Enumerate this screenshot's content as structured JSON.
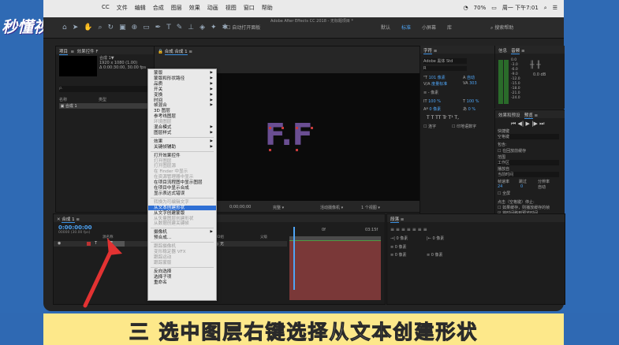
{
  "watermark": "秒懂视频",
  "mac_menu": [
    "CC",
    "文件",
    "编辑",
    "合成",
    "图层",
    "效果",
    "动画",
    "视图",
    "窗口",
    "帮助"
  ],
  "mac_status": {
    "battery": "70%",
    "clock": "周一 下午7:01"
  },
  "app_title": "Adobe After Effects CC 2018 - 无标题项目 *",
  "toolbar": {
    "snap_label": "自动打开面板",
    "workspaces": [
      "默认",
      "标准",
      "小屏幕",
      "库"
    ],
    "active_ws": "标准",
    "help_search": "搜索帮助"
  },
  "project_panel": {
    "tab": "项目",
    "tab2": "效果控件 F",
    "comp_name": "合成 1▼",
    "comp_info": "1920 x 1080 (1.00)",
    "duration": "Δ 0:00:30:00, 30.00 fps",
    "search_placeholder": "ρ.",
    "col_name": "名称",
    "col_type": "类型",
    "item": "合成 1"
  },
  "viewer": {
    "tab": "合成 合成 1",
    "letters": "F.F",
    "zoom": "完整",
    "camera": "活动摄像机",
    "view": "1 个视图",
    "timecode": "0;00;00;00"
  },
  "context_menu": {
    "items": [
      {
        "label": "蒙版",
        "sub": true,
        "dis": false
      },
      {
        "label": "蒙版和形状路径",
        "sub": true,
        "dis": false
      },
      {
        "label": "品质",
        "sub": true,
        "dis": false
      },
      {
        "label": "开关",
        "sub": true,
        "dis": false
      },
      {
        "label": "变换",
        "sub": true,
        "dis": false
      },
      {
        "label": "时间",
        "sub": true,
        "dis": false
      },
      {
        "label": "帧混合",
        "sub": true,
        "dis": false
      },
      {
        "label": "3D 图层",
        "sub": false,
        "dis": false
      },
      {
        "label": "参考线图层",
        "sub": false,
        "dis": false
      },
      {
        "label": "环境图层",
        "sub": false,
        "dis": true
      },
      {
        "label": "混合模式",
        "sub": true,
        "dis": false
      },
      {
        "label": "图层样式",
        "sub": true,
        "dis": false
      },
      {
        "label": "效果",
        "sub": true,
        "dis": false
      },
      {
        "label": "关键帧辅助",
        "sub": true,
        "dis": false
      },
      {
        "label": "打开效果控件",
        "sub": false,
        "dis": false
      },
      {
        "label": "打开图层",
        "sub": false,
        "dis": true
      },
      {
        "label": "打开图层源",
        "sub": false,
        "dis": true
      },
      {
        "label": "在 Finder 中显示",
        "sub": false,
        "dis": true
      },
      {
        "label": "在资源管理器中显示",
        "sub": false,
        "dis": true
      },
      {
        "label": "在项目流程图中显示图层",
        "sub": false,
        "dis": false
      },
      {
        "label": "在项目中显示合成",
        "sub": false,
        "dis": false
      },
      {
        "label": "显示表达式错误",
        "sub": false,
        "dis": false
      },
      {
        "label": "转换为可编辑文字",
        "sub": false,
        "dis": true
      },
      {
        "label": "从文本创建形状",
        "sub": false,
        "dis": false,
        "hi": true
      },
      {
        "label": "从文字创建蒙版",
        "sub": false,
        "dis": false
      },
      {
        "label": "从矢量图层创建形状",
        "sub": false,
        "dis": true
      },
      {
        "label": "从数据创建关键帧",
        "sub": false,
        "dis": true
      },
      {
        "label": "摄像机",
        "sub": true,
        "dis": false
      },
      {
        "label": "预合成...",
        "sub": false,
        "dis": false
      },
      {
        "label": "跟踪摄像机",
        "sub": false,
        "dis": true
      },
      {
        "label": "变形稳定器 VFX",
        "sub": false,
        "dis": true
      },
      {
        "label": "跟踪运动",
        "sub": false,
        "dis": true
      },
      {
        "label": "跟踪蒙版",
        "sub": false,
        "dis": true
      },
      {
        "label": "反向选择",
        "sub": false,
        "dis": false
      },
      {
        "label": "选择子项",
        "sub": false,
        "dis": false
      },
      {
        "label": "重命名",
        "sub": false,
        "dis": false
      }
    ]
  },
  "timeline": {
    "tab": "合成 1",
    "timecode": "0:00:00:00",
    "fps": "00000 (30.00 fps)",
    "col_source": "源名称",
    "col_parent": "父级",
    "col_mode": "3D组",
    "layer_name": "F",
    "parent_value": "无",
    "ruler_mid": "0f",
    "ruler_end": "03:15f"
  },
  "character_panel": {
    "tab": "字符",
    "font": "Adobe 黑体 Std",
    "style": "R",
    "size": "101 像素",
    "leading": "自动",
    "kerning": "度量标准",
    "tracking": "303",
    "stroke": "- 像素",
    "vscale": "100 %",
    "hscale": "100 %",
    "baseline": "0 像素",
    "tsume": "0 %",
    "styles": "T T TT Tr T¹ T,",
    "checkbox1": "连字",
    "checkbox2": "印地语数字"
  },
  "audio_panel": {
    "tab": "信息",
    "tab2": "音频",
    "levels": [
      "0.0",
      "-3.0",
      "-6.0",
      "-9.0",
      "-12.0",
      "-15.0",
      "-18.0",
      "-21.0",
      "-24.0"
    ],
    "db": "0.0 dB"
  },
  "preview_panel": {
    "tab1": "效果和预设",
    "tab2": "预览",
    "shortcut_label": "快捷键",
    "shortcut": "空格键",
    "include": "包含:",
    "cache": "在回放前缓存",
    "range_label": "范围",
    "range": "工作区",
    "play_from_label": "播放自",
    "play_from": "当前时间",
    "frame_rate_label": "帧速率",
    "skip_label": "跳过",
    "resolution_label": "分辨率",
    "frame_rate": "24",
    "skip": "0",
    "resolution": "自动",
    "fullscreen": "全屏",
    "stop_label": "点击（空格键）停止:",
    "stop1": "如果缓存，则播放缓存的帧",
    "stop2": "将时间移到预览时间"
  },
  "drawing_panel": {
    "tab": "段落",
    "fields": [
      "0 像素",
      "0 像素",
      "0 像素",
      "0 像素",
      "0 像素"
    ]
  },
  "caption": "三 选中图层右键选择从文本创建形状"
}
